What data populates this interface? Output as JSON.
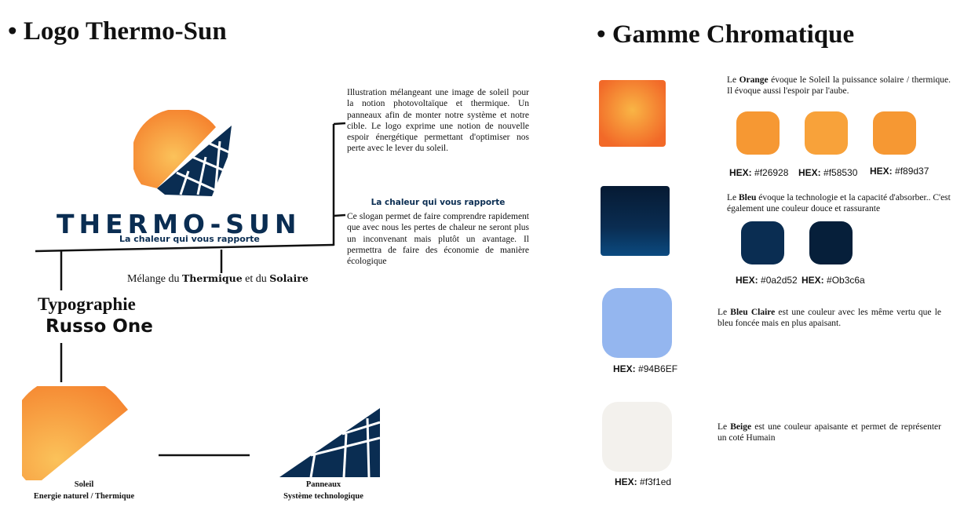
{
  "left": {
    "title": "Logo Thermo-Sun",
    "logo": {
      "wordmark": "THERMO-SUN",
      "tagline": "La chaleur qui vous rapporte"
    },
    "description": "Illustration mélangeant une image de soleil pour la notion photovoltaïque et thermique. Un panneaux afin de monter notre système et notre cible. Le logo exprime une notion de nouvelle espoir énergétique permettant d'optimiser nos perte avec le lever du soleil.",
    "slogan_title": "La chaleur qui vous rapporte",
    "slogan_text": "Ce slogan permet de faire comprendre rapidement que avec nous les pertes de chaleur ne seront plus un inconvenant mais plutôt un avantage. Il permettra de faire des économie de manière écologique",
    "blend": {
      "prefix": "Mélange du ",
      "b1": "Thermique",
      "mid": " et du ",
      "b2": "Solaire"
    },
    "typography_label": "Typographie",
    "typography_font": "Russo One",
    "sun_caption": {
      "title": "Soleil",
      "subtitle": "Energie naturel / Thermique"
    },
    "panel_caption": {
      "title": "Panneaux",
      "subtitle": "Système technologique"
    }
  },
  "right": {
    "title": "Gamme Chromatique",
    "hex_prefix": "HEX:",
    "orange": {
      "pre": "Le ",
      "name": "Orange",
      "text": " évoque le Soleil la puissance solaire / thermique. Il évoque aussi l'espoir par l'aube.",
      "swatches": [
        {
          "hex": "#f26928",
          "label": "#f26928"
        },
        {
          "hex": "#f58530",
          "label": "#f58530"
        },
        {
          "hex": "#f89d37",
          "label": "#f89d37"
        }
      ]
    },
    "blue": {
      "pre": "Le ",
      "name": "Bleu",
      "text": " évoque la technologie et la capacité d'absorber.. C'est également une couleur douce et rassurante",
      "swatches": [
        {
          "hex": "#0a2d52",
          "label": "#0a2d52"
        },
        {
          "hex": "#0b3c6a",
          "label": "#Ob3c6a"
        }
      ]
    },
    "light_blue": {
      "pre": "Le ",
      "name": "Bleu Claire",
      "text": " est une couleur avec les même vertu que le bleu foncée mais en plus apaisant.",
      "hex": "#94B6EF",
      "label": "#94B6EF"
    },
    "beige": {
      "pre": "Le ",
      "name": "Beige",
      "text": " est une couleur apaisante et permet de représenter un coté Humain",
      "hex": "#f3f1ed",
      "label": "#f3f1ed"
    }
  }
}
